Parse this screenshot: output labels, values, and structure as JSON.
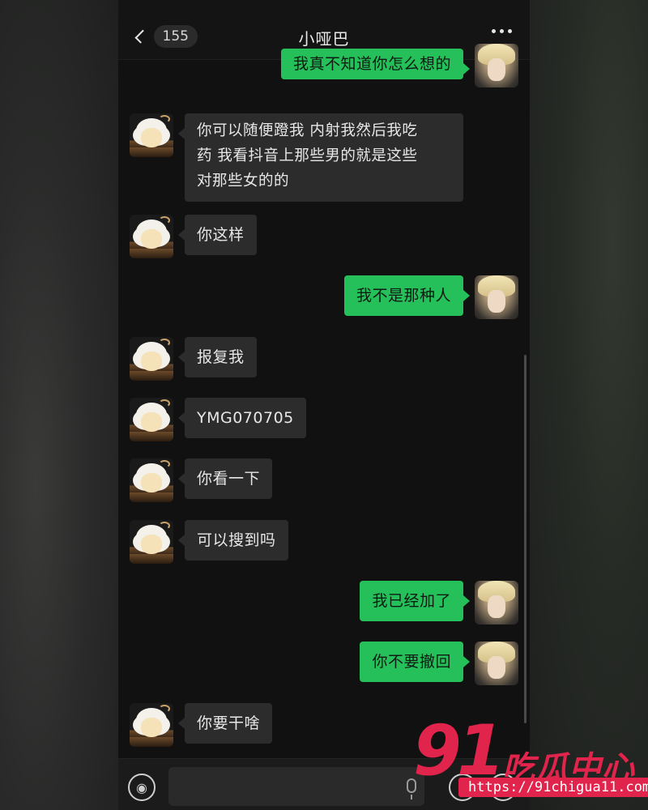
{
  "header": {
    "back_count": "155",
    "title": "小哑巴",
    "more_icon": "more-dots-icon"
  },
  "messages": [
    {
      "side": "out",
      "text": "我真不知道你怎么想的"
    },
    {
      "side": "in",
      "text": "你可以随便蹬我 内射我然后我吃\n药 我看抖音上那些男的就是这些\n对那些女的的"
    },
    {
      "side": "in",
      "text": "你这样"
    },
    {
      "side": "out",
      "text": "我不是那种人"
    },
    {
      "side": "in",
      "text": "报复我"
    },
    {
      "side": "in",
      "text": "YMG070705"
    },
    {
      "side": "in",
      "text": "你看一下"
    },
    {
      "side": "in",
      "text": "可以搜到吗"
    },
    {
      "side": "out",
      "text": "我已经加了"
    },
    {
      "side": "out",
      "text": "你不要撤回"
    },
    {
      "side": "in",
      "text": "你要干啥"
    }
  ],
  "input": {
    "value": "",
    "placeholder": ""
  },
  "watermark": {
    "number": "91",
    "brand": "吃瓜中心",
    "url": "https://91chigua11.com"
  },
  "colors": {
    "outgoing_bubble": "#25c05a",
    "incoming_bubble": "#2c2c2c",
    "watermark": "#e0244c"
  }
}
